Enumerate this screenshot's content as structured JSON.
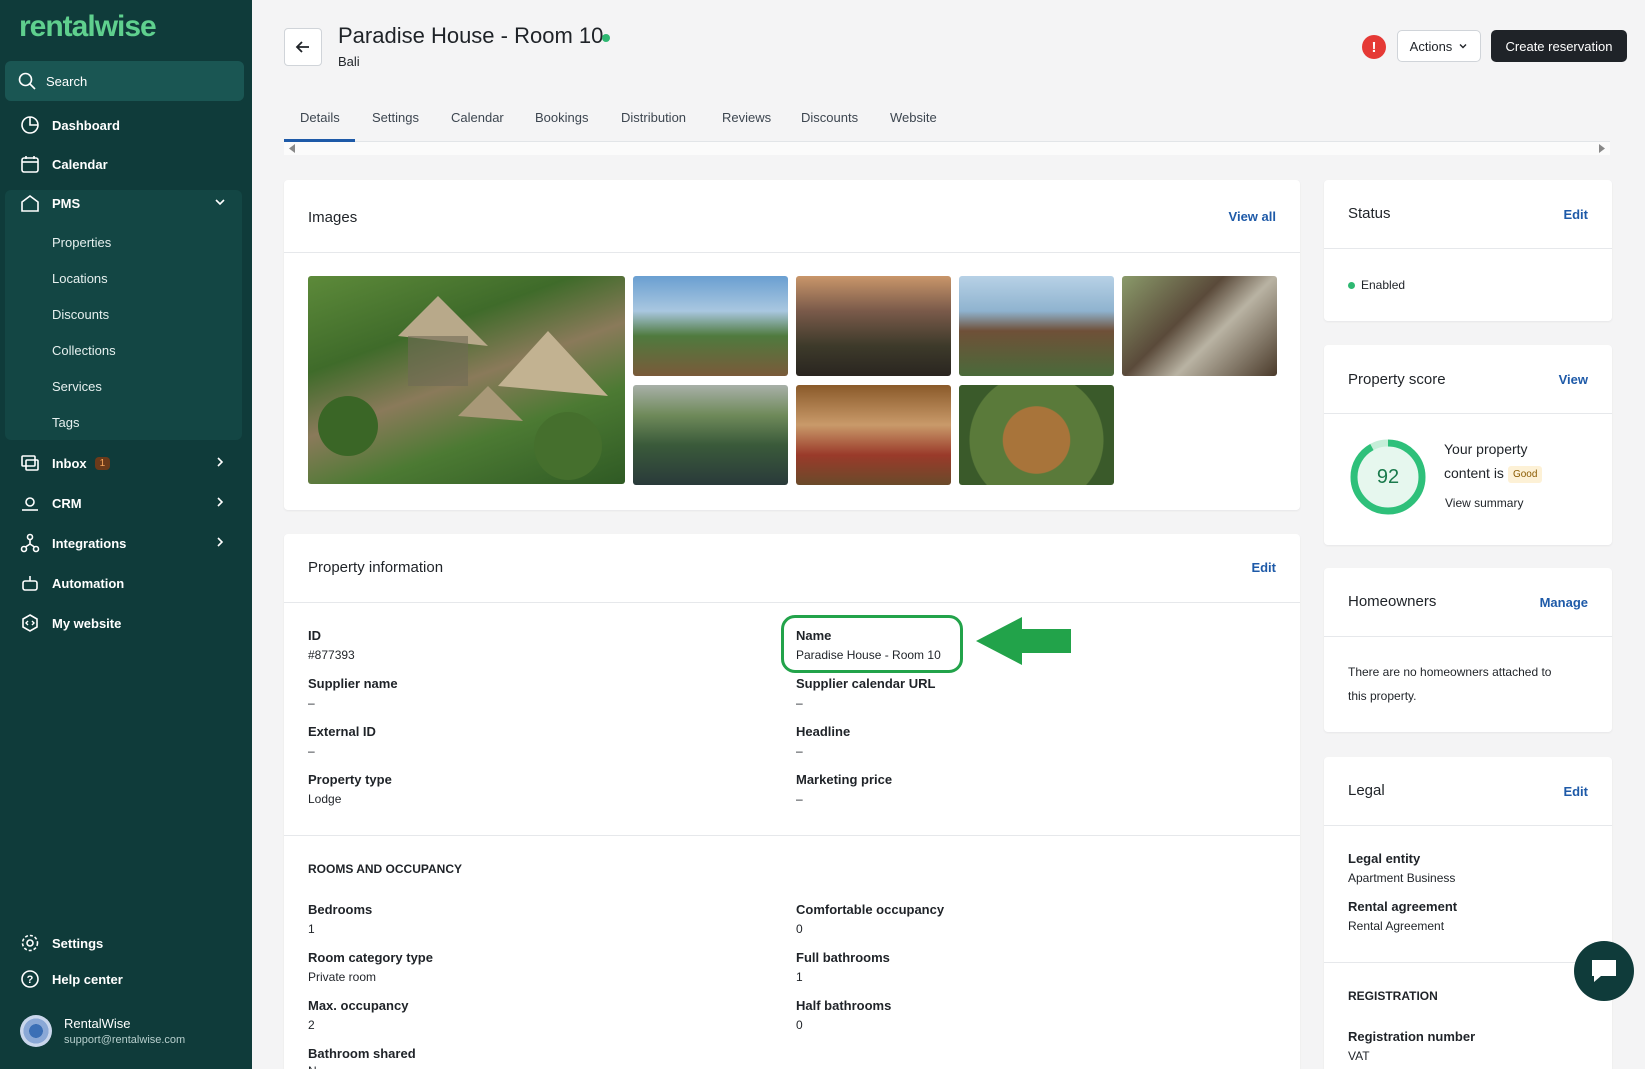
{
  "sidebar": {
    "logo": "rentalwise",
    "search_label": "Search",
    "nav": {
      "dashboard": "Dashboard",
      "calendar": "Calendar",
      "pms": "PMS",
      "inbox": "Inbox",
      "inbox_count": "1",
      "crm": "CRM",
      "integrations": "Integrations",
      "automation": "Automation",
      "my_website": "My website",
      "settings": "Settings",
      "help_center": "Help center"
    },
    "pms_items": [
      "Properties",
      "Locations",
      "Discounts",
      "Collections",
      "Services",
      "Tags"
    ],
    "user": {
      "name": "RentalWise",
      "email": "support@rentalwise.com"
    }
  },
  "header": {
    "title": "Paradise House - Room 10",
    "subtitle": "Bali",
    "alert": "!",
    "actions_label": "Actions",
    "create_label": "Create reservation"
  },
  "tabs": [
    "Details",
    "Settings",
    "Calendar",
    "Bookings",
    "Distribution",
    "Reviews",
    "Discounts",
    "Website"
  ],
  "images_card": {
    "title": "Images",
    "link": "View all"
  },
  "property_info": {
    "title": "Property information",
    "edit": "Edit",
    "fields": {
      "id_label": "ID",
      "id_value": "#877393",
      "name_label": "Name",
      "name_value": "Paradise House - Room 10",
      "supplier_name_label": "Supplier name",
      "supplier_name_value": "–",
      "supplier_cal_label": "Supplier calendar URL",
      "supplier_cal_value": "–",
      "external_id_label": "External ID",
      "external_id_value": "–",
      "headline_label": "Headline",
      "headline_value": "–",
      "property_type_label": "Property type",
      "property_type_value": "Lodge",
      "marketing_price_label": "Marketing price",
      "marketing_price_value": "–"
    },
    "rooms_section": "ROOMS AND OCCUPANCY",
    "rooms": {
      "bedrooms_label": "Bedrooms",
      "bedrooms_value": "1",
      "comfortable_label": "Comfortable occupancy",
      "comfortable_value": "0",
      "room_cat_label": "Room category type",
      "room_cat_value": "Private room",
      "full_bath_label": "Full bathrooms",
      "full_bath_value": "1",
      "max_occ_label": "Max. occupancy",
      "max_occ_value": "2",
      "half_bath_label": "Half bathrooms",
      "half_bath_value": "0",
      "bath_shared_label": "Bathroom shared",
      "bath_shared_value": "N"
    }
  },
  "status_card": {
    "title": "Status",
    "edit": "Edit",
    "value": "Enabled"
  },
  "score_card": {
    "title": "Property score",
    "link": "View",
    "score": "92",
    "line1": "Your property",
    "line2": "content is",
    "badge": "Good",
    "summary": "View summary"
  },
  "homeowners_card": {
    "title": "Homeowners",
    "link": "Manage",
    "text1": "There are no homeowners attached to",
    "text2": "this property."
  },
  "legal_card": {
    "title": "Legal",
    "edit": "Edit",
    "entity_label": "Legal entity",
    "entity_value": "Apartment Business",
    "agreement_label": "Rental agreement",
    "agreement_value": "Rental Agreement",
    "registration_section": "REGISTRATION",
    "reg_number_label": "Registration number",
    "reg_number_value": "VAT"
  },
  "colors": {
    "sidebar": "#0f3b3a",
    "accent_green": "#2eb872",
    "link_blue": "#1e5aa8",
    "highlight": "#22a34a"
  }
}
